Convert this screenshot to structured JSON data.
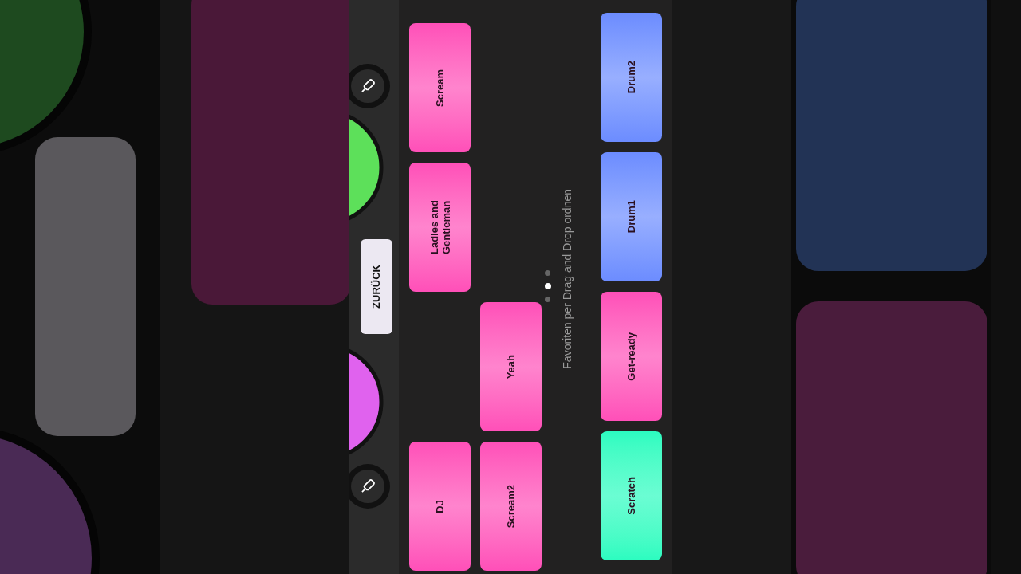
{
  "back_button": {
    "label": "ZURÜCK"
  },
  "knobs": [
    {
      "color": "#5de05a"
    },
    {
      "color": "#e062ee"
    }
  ],
  "pad_columns": [
    {
      "pads": [
        {
          "kind": "pad",
          "label": "Scream",
          "color": "#ff4fb8"
        },
        {
          "kind": "pad",
          "label": "Ladies and Gentleman",
          "color": "#ff4fb8"
        },
        {
          "kind": "empty"
        },
        {
          "kind": "pad",
          "label": "DJ",
          "color": "#ff4fb8"
        }
      ]
    },
    {
      "pads": [
        {
          "kind": "empty"
        },
        {
          "kind": "empty"
        },
        {
          "kind": "pad",
          "label": "Yeah",
          "color": "#ff4fb8"
        },
        {
          "kind": "pad",
          "label": "Scream2",
          "color": "#ff4fb8"
        }
      ]
    }
  ],
  "hint": "Favoriten per Drag and Drop ordnen",
  "pages": [
    {
      "selected": false
    },
    {
      "selected": true
    },
    {
      "selected": false
    }
  ],
  "favorites": [
    {
      "kind": "pad",
      "label": "Drum2",
      "color": "#6c8cff"
    },
    {
      "kind": "pad",
      "label": "Drum1",
      "color": "#6c8cff"
    },
    {
      "kind": "pad",
      "label": "Get-ready",
      "color": "#ff4fb8"
    },
    {
      "kind": "pad",
      "label": "Scratch",
      "color": "#2bfcc0"
    }
  ]
}
